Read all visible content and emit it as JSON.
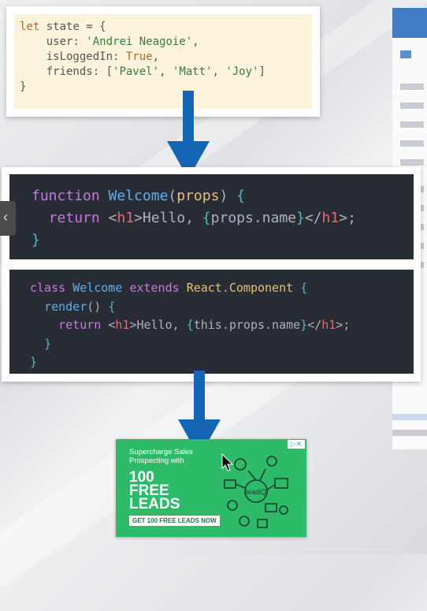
{
  "state_snippet": {
    "lines": [
      "let state = {",
      "    user: 'Andrei Neagoie',",
      "    isLoggedIn: True,",
      "    friends: ['Pavel', 'Matt', 'Joy']",
      "}"
    ]
  },
  "function_snippet": {
    "lines": [
      "function Welcome(props) {",
      "  return <h1>Hello, {props.name}</h1>;",
      "}"
    ]
  },
  "class_snippet": {
    "lines": [
      "class Welcome extends React.Component {",
      "  render() {",
      "    return <h1>Hello, {this.props.name}</h1>;",
      "  }",
      "}"
    ]
  },
  "nav": {
    "prev_icon": "chevron-left-icon",
    "prev_glyph": "‹"
  },
  "ad": {
    "subtitle": "Supercharge Sales Prospecting with",
    "headline_1": "100",
    "headline_2": "FREE",
    "headline_3": "LEADS",
    "cta": "GET 100 FREE LEADS NOW",
    "brand": "leadiQ",
    "badge": "▷✕",
    "background": "#2dbb6a"
  },
  "colors": {
    "arrow": "#1565b5",
    "code_bg": "#282c34",
    "state_bg": "#fcf3dd"
  }
}
